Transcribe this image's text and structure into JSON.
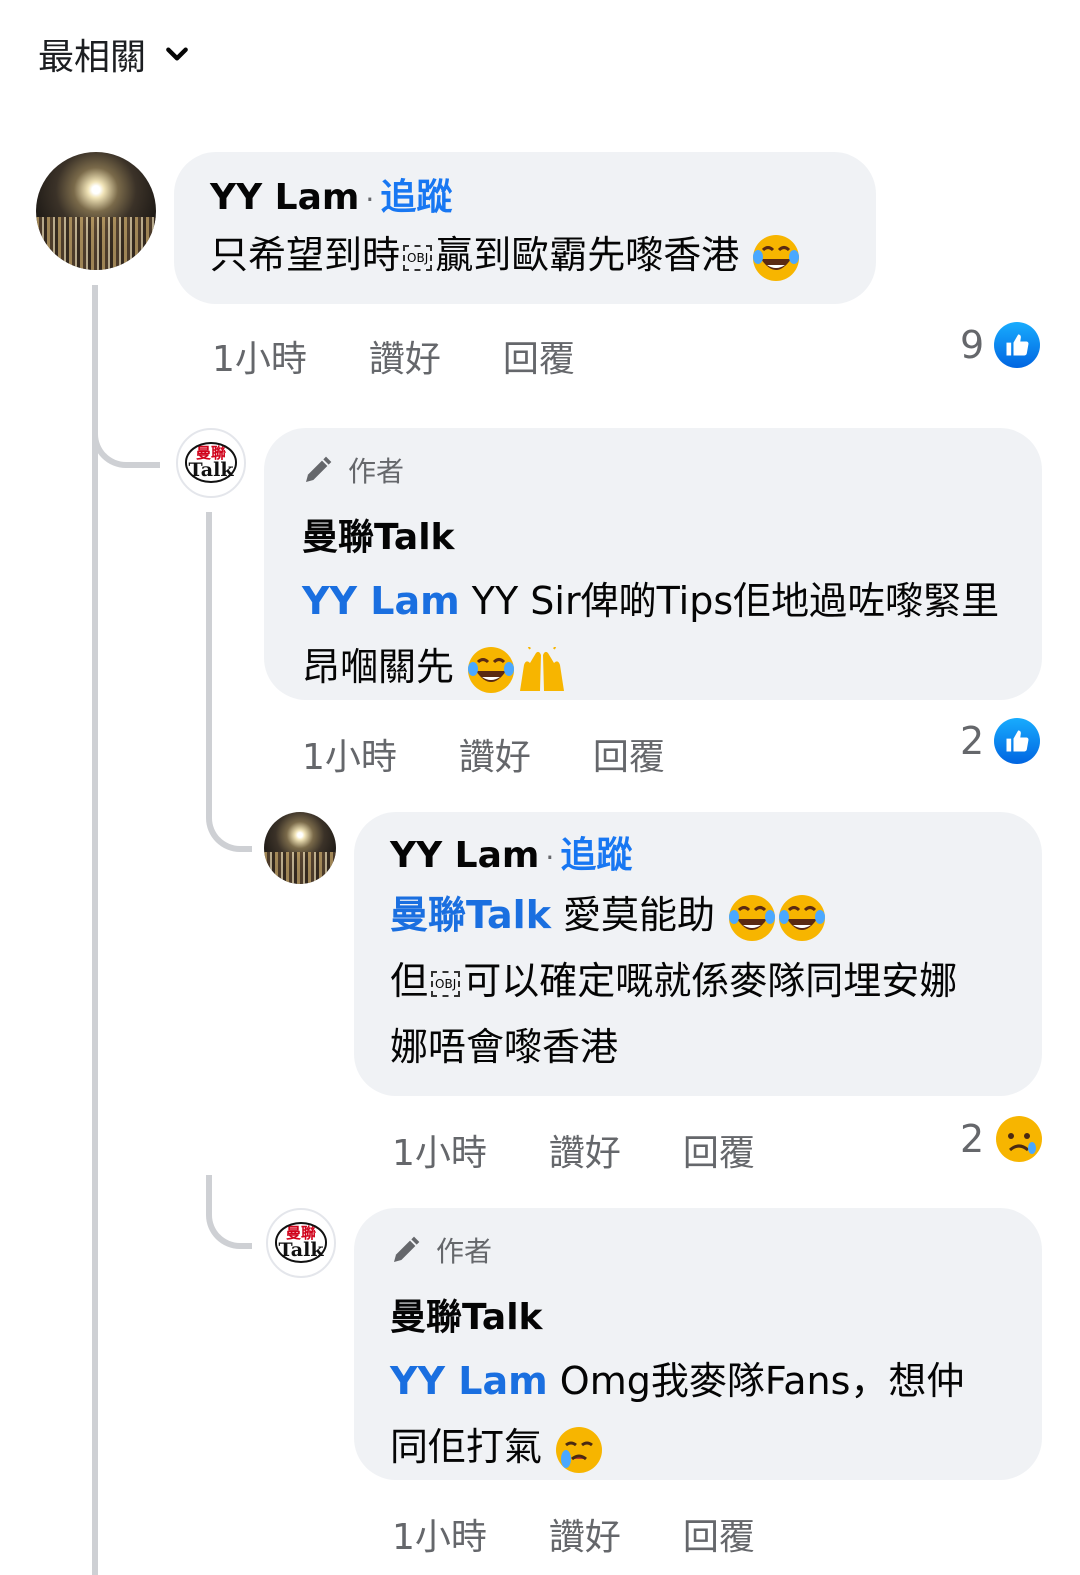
{
  "sort": {
    "label": "最相關"
  },
  "colors": {
    "link": "#1877f2",
    "bubble": "#f0f2f5",
    "muted": "#65676b"
  },
  "comments": [
    {
      "author": "YY Lam",
      "follow": "追蹤",
      "text_before": "只希望到時",
      "obj": "OBJ",
      "text_after": "贏到歐霸先嚟香港",
      "time": "1小時",
      "like": "讚好",
      "reply": "回覆",
      "reaction_count": "9",
      "reaction_icon": "like-icon"
    },
    {
      "badge": "作者",
      "author": "曼聯Talk",
      "mention": "YY Lam",
      "text": " YY Sir俾啲Tips佢地過咗嚟緊里昂嗰關先",
      "time": "1小時",
      "like": "讚好",
      "reply": "回覆",
      "reaction_count": "2",
      "reaction_icon": "like-icon"
    },
    {
      "author": "YY Lam",
      "follow": "追蹤",
      "mention": "曼聯Talk",
      "line1": " 愛莫能助",
      "line2_before": "但",
      "obj": "OBJ",
      "line2_after": "可以確定嘅就係麥隊同埋安娜",
      "line3": "娜唔會嚟香港",
      "time": "1小時",
      "like": "讚好",
      "reply": "回覆",
      "reaction_count": "2",
      "reaction_icon": "sad-icon"
    },
    {
      "badge": "作者",
      "author": "曼聯Talk",
      "mention": "YY Lam",
      "line1": " Omg我麥隊Fans，想仲",
      "line2": "同佢打氣",
      "time": "1小時",
      "like": "讚好",
      "reply": "回覆"
    }
  ],
  "logo": {
    "zh": "曼聯",
    "en": "Talk"
  }
}
